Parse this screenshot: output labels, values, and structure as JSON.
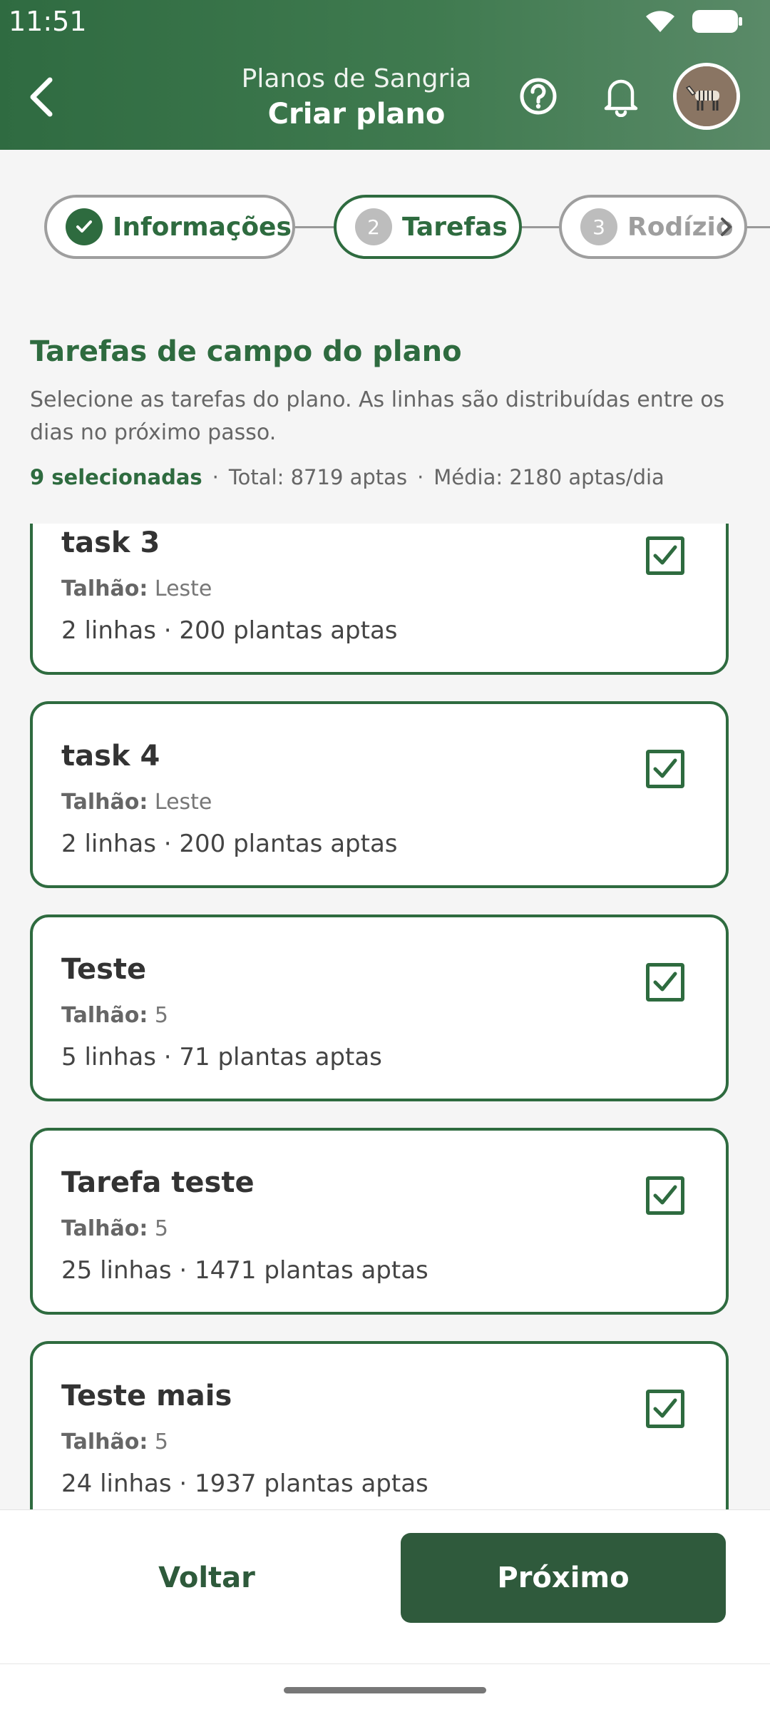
{
  "status_bar": {
    "time": "11:51"
  },
  "header": {
    "subtitle": "Planos de Sangria",
    "title": "Criar plano"
  },
  "stepper": {
    "steps": [
      {
        "number": "✓",
        "label": "Informações",
        "state": "done"
      },
      {
        "number": "2",
        "label": "Tarefas",
        "state": "active"
      },
      {
        "number": "3",
        "label": "Rodízio",
        "state": "upcoming"
      }
    ]
  },
  "section": {
    "title": "Tarefas de campo do plano",
    "description": "Selecione as tarefas do plano. As linhas são distribuídas entre os dias no próximo passo.",
    "summary": {
      "selected": "9 selecionadas",
      "total": "Total: 8719 aptas",
      "average": "Média: 2180 aptas/dia"
    }
  },
  "tasks": [
    {
      "name": "task 3",
      "talhao_label": "Talhão:",
      "talhao": "Leste",
      "meta": "2 linhas · 200 plantas aptas",
      "checked": true
    },
    {
      "name": "task 4",
      "talhao_label": "Talhão:",
      "talhao": "Leste",
      "meta": "2 linhas · 200 plantas aptas",
      "checked": true
    },
    {
      "name": "Teste",
      "talhao_label": "Talhão:",
      "talhao": "5",
      "meta": "5 linhas · 71 plantas aptas",
      "checked": true
    },
    {
      "name": "Tarefa teste",
      "talhao_label": "Talhão:",
      "talhao": "5",
      "meta": "25 linhas · 1471 plantas aptas",
      "checked": true
    },
    {
      "name": "Teste mais",
      "talhao_label": "Talhão:",
      "talhao": "5",
      "meta": "24 linhas · 1937 plantas aptas",
      "checked": true
    }
  ],
  "footer": {
    "back_label": "Voltar",
    "next_label": "Próximo"
  },
  "colors": {
    "primary": "#2e6b3f",
    "primary_dark": "#2f5a3c",
    "muted": "#9e9e9e"
  }
}
